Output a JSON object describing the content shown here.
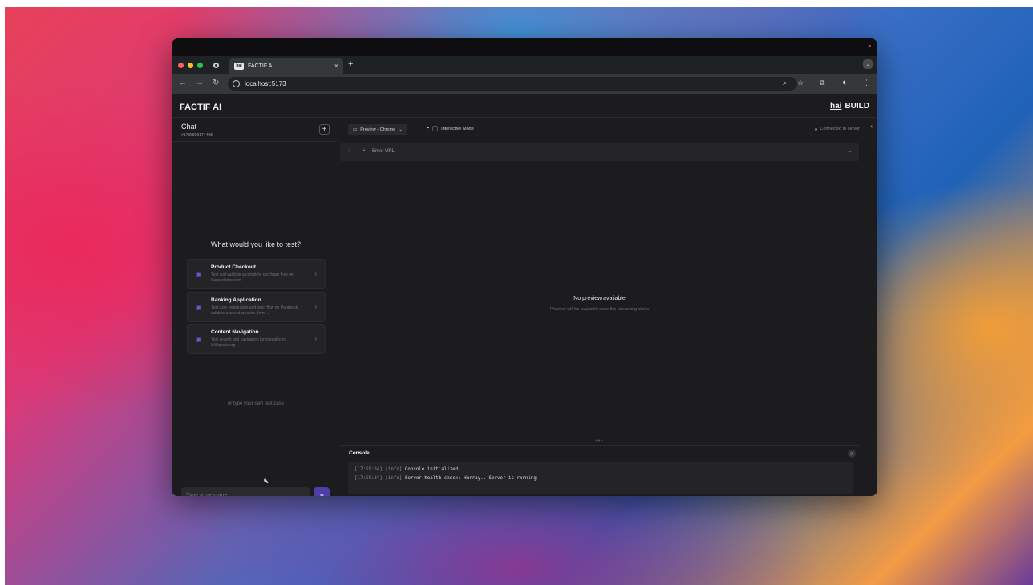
{
  "browser": {
    "tab_title": "FACTIF AI",
    "tab_favicon_text": "hai",
    "address": "localhost:5173"
  },
  "app": {
    "title": "FACTIF AI",
    "brand_hai": "hai",
    "brand_build": "BUILD"
  },
  "chat": {
    "title": "Chat",
    "session_id": "#1736899174498",
    "question": "What would you like to test?",
    "cards": [
      {
        "title": "Product Checkout",
        "description": "Test and validate a complete purchase flow on Saucedemo.com",
        "icon": "cart-icon"
      },
      {
        "title": "Banking Application",
        "description": "Test user registration and login flow on Parabank, validate account creation, form...",
        "icon": "bank-icon"
      },
      {
        "title": "Content Navigation",
        "description": "Test search and navigation functionality on Wikipedia.org",
        "icon": "book-icon"
      }
    ],
    "or_text": "or type your own test case",
    "input_placeholder": "Type a message..."
  },
  "preview": {
    "select_label": "Preview - Chrome",
    "mode_label": "Interactive Mode",
    "connection_status": "Connected to server",
    "url_placeholder": "Enter URL",
    "empty_title": "No preview available",
    "empty_subtitle": "Preview will be available once the streaming starts"
  },
  "console": {
    "title": "Console",
    "logs": [
      {
        "time": "[17:59:34]",
        "level": "[info]",
        "message": "Console initialized"
      },
      {
        "time": "[17:59:34]",
        "level": "[info]",
        "message": "Server health check: Hurray.. Server is running"
      }
    ]
  },
  "colors": {
    "accent": "#4b3fa8",
    "background": "#1c1c1e"
  }
}
